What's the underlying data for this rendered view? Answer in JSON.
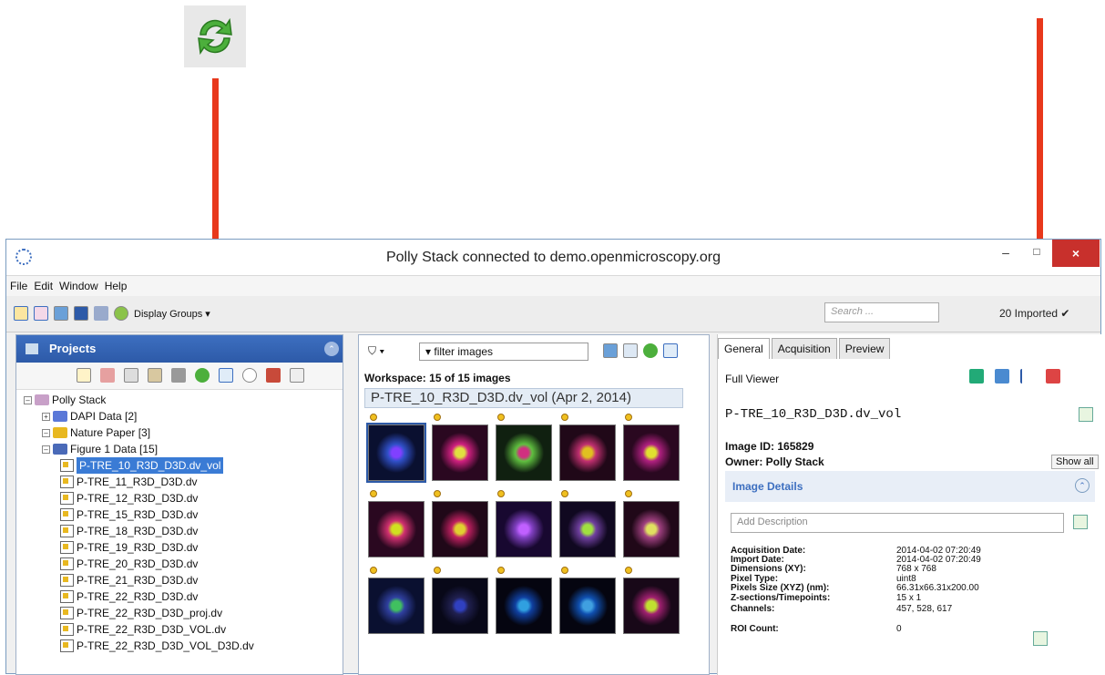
{
  "window": {
    "title": "Polly Stack connected to demo.openmicroscopy.org",
    "close_label": "×",
    "min_label": "–",
    "max_label": "□"
  },
  "menu": [
    "File",
    "Edit",
    "Window",
    "Help"
  ],
  "toolbar": {
    "display_groups_label": "Display Groups ▾",
    "search_placeholder": "Search ...",
    "imported_label": "20 Imported ✔"
  },
  "left": {
    "header": "Projects",
    "tree": [
      {
        "label": "Polly Stack",
        "level": 0
      },
      {
        "label": "DAPI Data [2]",
        "level": 1
      },
      {
        "label": "Nature Paper [3]",
        "level": 1
      },
      {
        "label": "Figure 1 Data [15]",
        "level": 2
      },
      {
        "label": "P-TRE_10_R3D_D3D.dv_vol",
        "level": 3,
        "selected": true
      },
      {
        "label": "P-TRE_11_R3D_D3D.dv",
        "level": 3
      },
      {
        "label": "P-TRE_12_R3D_D3D.dv",
        "level": 3
      },
      {
        "label": "P-TRE_15_R3D_D3D.dv",
        "level": 3
      },
      {
        "label": "P-TRE_18_R3D_D3D.dv",
        "level": 3
      },
      {
        "label": "P-TRE_19_R3D_D3D.dv",
        "level": 3
      },
      {
        "label": "P-TRE_20_R3D_D3D.dv",
        "level": 3
      },
      {
        "label": "P-TRE_21_R3D_D3D.dv",
        "level": 3
      },
      {
        "label": "P-TRE_22_R3D_D3D.dv",
        "level": 3
      },
      {
        "label": "P-TRE_22_R3D_D3D_proj.dv",
        "level": 3
      },
      {
        "label": "P-TRE_22_R3D_D3D_VOL.dv",
        "level": 3
      },
      {
        "label": "P-TRE_22_R3D_D3D_VOL_D3D.dv",
        "level": 3
      }
    ]
  },
  "middle": {
    "filter_label": "▾ filter images",
    "workspace": "Workspace: 15 of 15 images",
    "series_title": "P-TRE_10_R3D_D3D.dv_vol (Apr 2, 2014)"
  },
  "right": {
    "tabs": [
      "General",
      "Acquisition",
      "Preview"
    ],
    "full_viewer": "Full Viewer",
    "image_name": "P-TRE_10_R3D_D3D.dv_vol",
    "image_id": "Image ID: 165829",
    "owner": "Owner: Polly Stack",
    "show_all": "Show all",
    "image_details": "Image Details",
    "description_placeholder": "Add Description",
    "meta": [
      {
        "label": "Acquisition Date:",
        "value": "2014-04-02 07:20:49"
      },
      {
        "label": "Import Date:",
        "value": "2014-04-02 07:20:49"
      },
      {
        "label": "Dimensions (XY):",
        "value": "768 x 768"
      },
      {
        "label": "Pixel Type:",
        "value": "uint8"
      },
      {
        "label": "Pixels Size (XYZ) (nm):",
        "value": "66.31x66.31x200.00"
      },
      {
        "label": "Z-sections/Timepoints:",
        "value": "15 x 1"
      },
      {
        "label": "Channels:",
        "value": "457, 528, 617"
      },
      {
        "label": "ROI Count:",
        "value": "0"
      }
    ]
  },
  "colors": {
    "accent": "#2d5aa8",
    "arrow": "#e8381c",
    "close": "#c8302c"
  }
}
